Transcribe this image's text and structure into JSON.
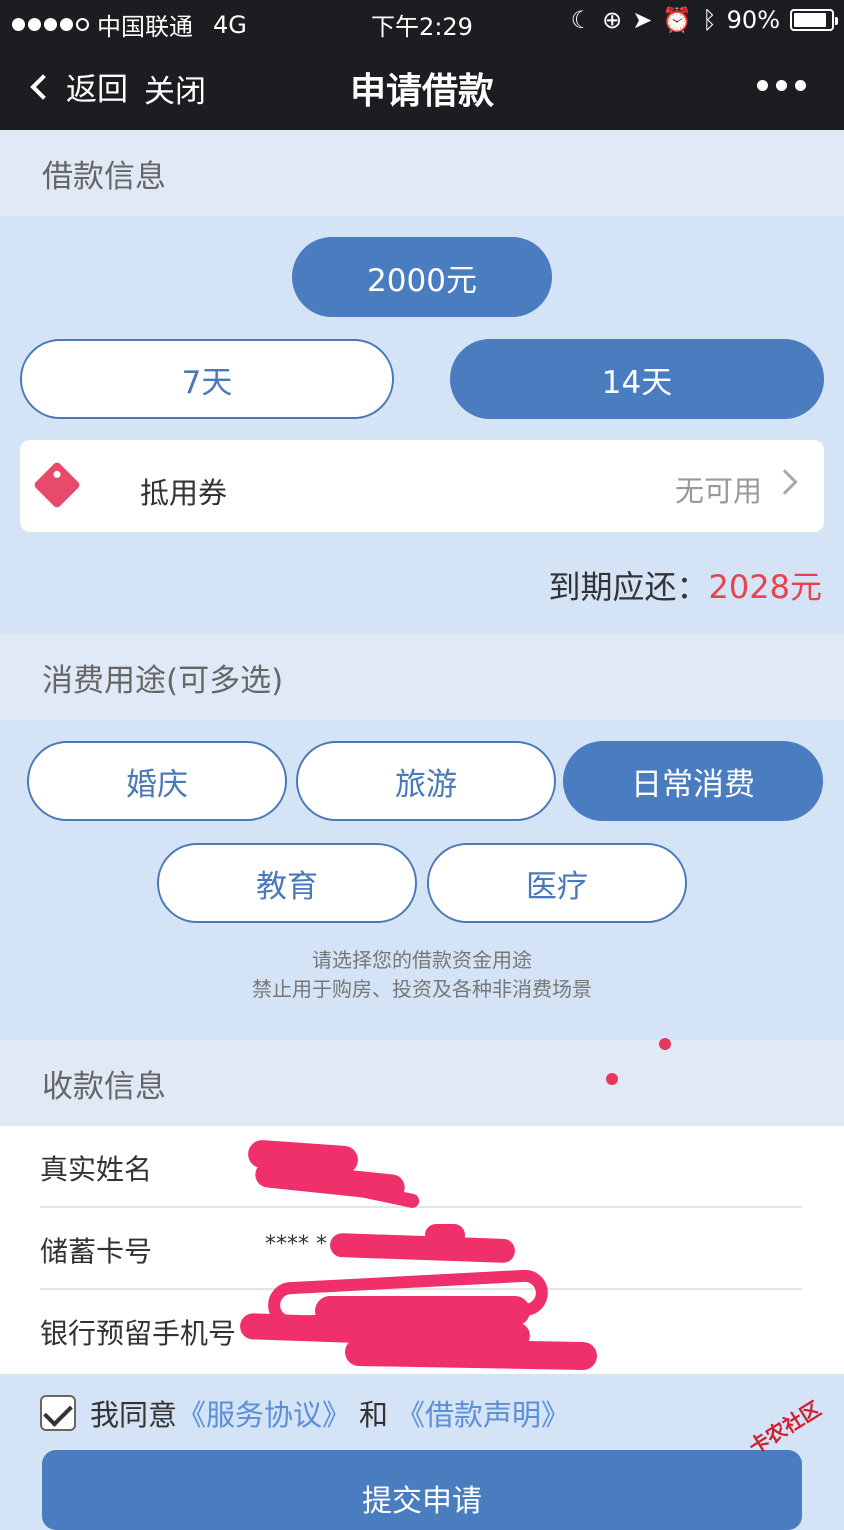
{
  "status": {
    "carrier": "中国联通",
    "network": "4G",
    "time": "下午2:29",
    "battery": "90%",
    "battery_level": 0.9
  },
  "nav": {
    "back": "返回",
    "close": "关闭",
    "title": "申请借款"
  },
  "loan_info": {
    "heading": "借款信息",
    "amount": "2000元",
    "terms": [
      "7天",
      "14天"
    ],
    "selected_term": "14天"
  },
  "coupon": {
    "label": "抵用券",
    "value": "无可用"
  },
  "due": {
    "label": "到期应还：",
    "amount": "2028元"
  },
  "purpose": {
    "heading": "消费用途(可多选)",
    "options": [
      "婚庆",
      "旅游",
      "日常消费",
      "教育",
      "医疗"
    ],
    "selected": "日常消费",
    "hint1": "请选择您的借款资金用途",
    "hint2": "禁止用于购房、投资及各种非消费场景"
  },
  "receive": {
    "heading": "收款信息",
    "name_label": "真实姓名",
    "card_label": "储蓄卡号",
    "card_value": "**** *",
    "phone_label": "银行预留手机号"
  },
  "agreement": {
    "prefix": "我同意",
    "service": "《服务协议》",
    "and": "和",
    "statement": "《借款声明》"
  },
  "submit_label": "提交申请",
  "watermark": "卡农社区",
  "colors": {
    "accent": "#4a7cc0",
    "due": "#e8434d",
    "navbar": "#1c1d21"
  }
}
